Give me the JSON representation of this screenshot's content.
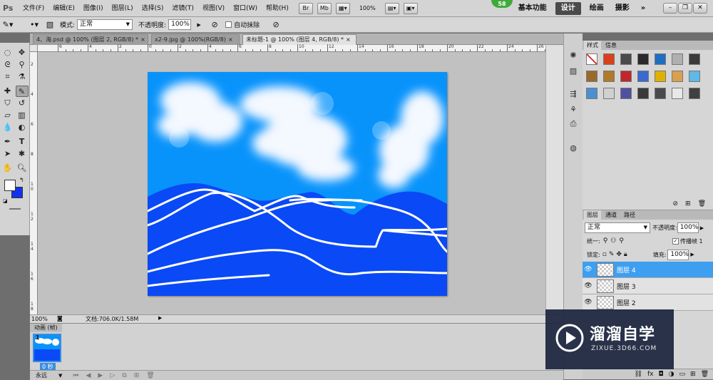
{
  "app": {
    "logo": "Ps",
    "menu": [
      "文件(F)",
      "编辑(E)",
      "图像(I)",
      "图层(L)",
      "选择(S)",
      "滤镜(T)",
      "视图(V)",
      "窗口(W)",
      "帮助(H)"
    ],
    "bridge_btn": "Br",
    "minibridge_btn": "Mb",
    "zoom": "100%",
    "workspaces": [
      "基本功能",
      "设计",
      "绘画",
      "摄影"
    ],
    "active_workspace": "设计",
    "more": "»",
    "badge": "58"
  },
  "options": {
    "mode_label": "模式:",
    "mode_value": "正常",
    "opacity_label": "不透明度:",
    "opacity_value": "100%",
    "auto_erase_label": "自动抹除"
  },
  "documents": {
    "tabs": [
      {
        "label": "4、海.psd @ 100% (图层 2, RGB/8) *",
        "active": false
      },
      {
        "label": "x2-9.jpg @ 100%(RGB/8)",
        "active": false
      },
      {
        "label": "未标题-1 @ 100% (图层 4, RGB/8) *",
        "active": true
      }
    ],
    "close_symbol": "×"
  },
  "rulers": {
    "h_labels": [
      "6",
      "4",
      "2",
      "0",
      "2",
      "4",
      "6",
      "8",
      "10",
      "12",
      "14",
      "16",
      "18",
      "20",
      "22",
      "24",
      "26"
    ],
    "v_labels": [
      "2",
      "4",
      "6",
      "8",
      "1 0",
      "1 2",
      "1 4",
      "1 6",
      "1 8"
    ]
  },
  "status": {
    "zoom": "100%",
    "doc_info": "文档:706.0K/1.58M"
  },
  "animation": {
    "tab_label": "动画 (帧)",
    "frame_number": "1",
    "frame_delay": "0 秒",
    "loop": "永远"
  },
  "styles_panel": {
    "tabs": [
      "样式",
      "信息"
    ],
    "swatch_colors": [
      "#ffffff",
      "#d8401e",
      "#4a4a4a",
      "#2a2a2a",
      "#1f6fc0",
      "#b0b0b0",
      "#3a3a3a",
      "#9a6a2a",
      "#b07a2a",
      "#c0262a",
      "#3a6ad0",
      "#e0b000",
      "#d8a050",
      "#60b8e8",
      "#4a90d0",
      "#d0d0d0",
      "#5050a0",
      "#3a3a3a",
      "#4a4a4a",
      "#e8e8e8",
      "#404040"
    ]
  },
  "layers_panel": {
    "tabs": [
      "图层",
      "通道",
      "路径"
    ],
    "blend_mode": "正常",
    "opacity_label": "不透明度:",
    "opacity_value": "100%",
    "unify_label": "统一:",
    "propagate_label": "传播帧 1",
    "lock_label": "锁定:",
    "fill_label": "填充:",
    "fill_value": "100%",
    "layers": [
      {
        "name": "图层 4",
        "selected": true
      },
      {
        "name": "图层 3",
        "selected": false
      },
      {
        "name": "图层 2",
        "selected": false
      }
    ]
  },
  "watermark": {
    "title": "溜溜自学",
    "url": "ZIXUE.3D66.COM"
  },
  "colors": {
    "sky": "#0893fb",
    "mountain": "#0a49f6",
    "selection": "#3e9ff0"
  }
}
